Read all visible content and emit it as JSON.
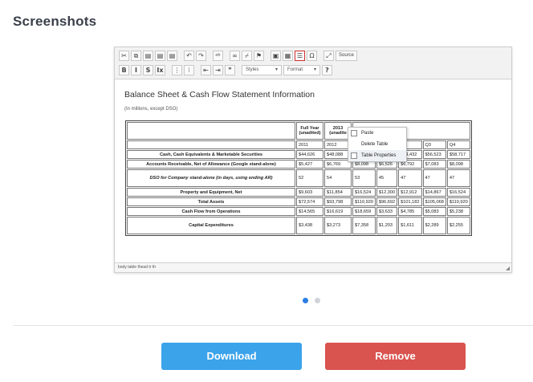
{
  "section_title": "Screenshots",
  "preview": {
    "toolbar": {
      "row1": [
        {
          "name": "cut-icon",
          "glyph": "✂"
        },
        {
          "name": "copy-icon",
          "glyph": "⧉"
        },
        {
          "name": "paste-icon",
          "glyph": "▤"
        },
        {
          "name": "paste-text-icon",
          "glyph": "▤"
        },
        {
          "name": "paste-word-icon",
          "glyph": "▤"
        },
        {
          "name": "undo-icon",
          "glyph": "↶"
        },
        {
          "name": "redo-icon",
          "glyph": "↷"
        },
        {
          "name": "spellcheck-icon",
          "glyph": "ᵃᵇ"
        },
        {
          "name": "link-icon",
          "glyph": "∞"
        },
        {
          "name": "unlink-icon",
          "glyph": "⌿"
        },
        {
          "name": "anchor-icon",
          "glyph": "⚑"
        },
        {
          "name": "image-icon",
          "glyph": "▣"
        },
        {
          "name": "table-icon",
          "glyph": "▦"
        },
        {
          "name": "horizontal-line-icon",
          "glyph": "☰"
        },
        {
          "name": "special-char-icon",
          "glyph": "Ω"
        },
        {
          "name": "maximize-icon",
          "glyph": "⤢"
        }
      ],
      "source_label": "Source",
      "row2": [
        {
          "name": "bold-icon",
          "glyph": "B"
        },
        {
          "name": "italic-icon",
          "glyph": "I"
        },
        {
          "name": "strike-icon",
          "glyph": "S"
        },
        {
          "name": "remove-format-icon",
          "glyph": "Ix"
        },
        {
          "name": "numbered-list-icon",
          "glyph": "⋮"
        },
        {
          "name": "bulleted-list-icon",
          "glyph": "⁝"
        },
        {
          "name": "outdent-icon",
          "glyph": "⇤"
        },
        {
          "name": "indent-icon",
          "glyph": "⇥"
        },
        {
          "name": "blockquote-icon",
          "glyph": "❞"
        }
      ],
      "styles_label": "Styles",
      "format_label": "Format",
      "help_glyph": "?"
    },
    "doc_title": "Balance Sheet & Cash Flow Statement Information",
    "doc_subtitle": "(In millions, except DSO)",
    "table": {
      "header1": [
        "",
        "Full Year (unadited)",
        "2013 (unadite"
      ],
      "header2": [
        "",
        "2011",
        "2012",
        "",
        "",
        "Q2",
        "Q3",
        "Q4"
      ],
      "rows": [
        {
          "label": "Cash, Cash Equivalents & Marketable Securities",
          "italic": false,
          "cells": [
            "$44,626",
            "$48,088",
            "",
            "",
            "$54,432",
            "$56,523",
            "$58,717"
          ]
        },
        {
          "label": "Accounts Receivable, Net of Allowance (Google stand-alone)",
          "italic": false,
          "cells": [
            "$5,427",
            "$6,769",
            "$8,098",
            "$6,526",
            "$6,792",
            "$7,083",
            "$8,098"
          ]
        },
        {
          "label": "DSO for Company stand-alone (in days, using ending AR)",
          "italic": true,
          "cells": [
            "52",
            "54",
            "53",
            "45",
            "47",
            "47",
            "47"
          ]
        },
        {
          "label": "Property and Equipment, Net",
          "italic": false,
          "cells": [
            "$9,603",
            "$11,854",
            "$16,524",
            "$12,300",
            "$12,912",
            "$14,867",
            "$16,524"
          ]
        },
        {
          "label": "Total Assets",
          "italic": false,
          "cells": [
            "$72,574",
            "$93,798",
            "$110,920",
            "$96,692",
            "$101,182",
            "$105,068",
            "$110,920"
          ]
        },
        {
          "label": "Cash Flow from Operations",
          "italic": false,
          "cells": [
            "$14,565",
            "$16,619",
            "$18,659",
            "$3,633",
            "$4,785",
            "$5,083",
            "$5,238"
          ]
        },
        {
          "label": "Capital Expenditures",
          "italic": false,
          "cells": [
            "$3,438",
            "$3,273",
            "$7,358",
            "$1,203",
            "$1,611",
            "$2,289",
            "$2,255"
          ]
        }
      ]
    },
    "context_menu": [
      "Paste",
      "Delete Table",
      "Table Properties"
    ],
    "status_path": "body  table  thead  tr  th"
  },
  "actions": {
    "download_label": "Download",
    "remove_label": "Remove"
  },
  "colors": {
    "download": "#3ba3ea",
    "remove": "#d9534f",
    "dot_active": "#2b7de3"
  }
}
